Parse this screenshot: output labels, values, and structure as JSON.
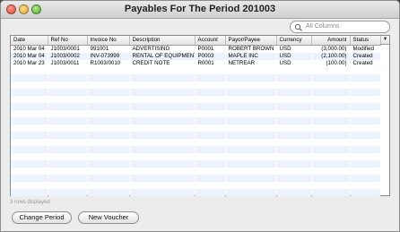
{
  "window": {
    "title": "Payables For The Period 201003"
  },
  "search": {
    "placeholder": "All Columns"
  },
  "table": {
    "columns": [
      "Date",
      "Ref No",
      "Invoice No",
      "Description",
      "Account",
      "Payor/Payee",
      "Currency",
      "Amount",
      "Status"
    ],
    "rows": [
      [
        "2010 Mar 04",
        "J1003/0001",
        "991001",
        "ADVERTISING",
        "P0001",
        "ROBERT BROWN",
        "USD",
        "(3,000.00)",
        "Modified"
      ],
      [
        "2010 Mar 04",
        "J1003/0002",
        "INV-073999",
        "RENTAL OF EQUIPMENT",
        "P0003",
        "MAPLE INC",
        "USD",
        "(2,100.00)",
        "Created"
      ],
      [
        "2010 Mar 23",
        "J1003/0011",
        "R1003/0010",
        "CREDIT NOTE",
        "R0001",
        "NETREAR",
        "USD",
        "(100.00)",
        "Created"
      ]
    ],
    "sort_indicator": "▼"
  },
  "status": {
    "rows_displayed": "3 rows displayed"
  },
  "buttons": {
    "change_period": "Change Period",
    "new_voucher": "New Voucher"
  }
}
